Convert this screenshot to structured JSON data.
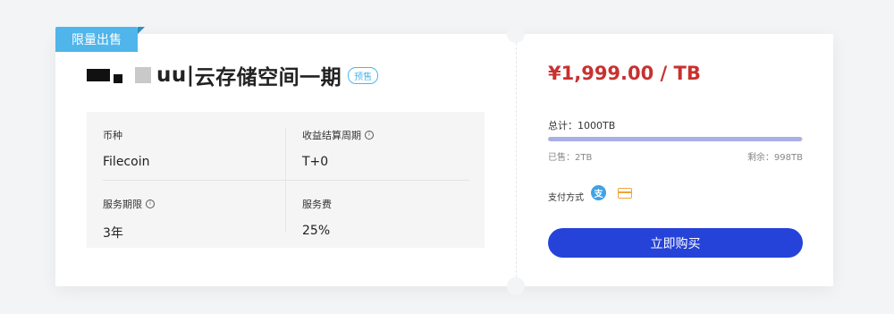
{
  "ribbon": {
    "label": "限量出售"
  },
  "product": {
    "title": "云存储空间一期",
    "title_partial": "uu|",
    "tag": "预售"
  },
  "details": {
    "coin": {
      "label": "币种",
      "value": "Filecoin"
    },
    "settlement_cycle": {
      "label": "收益结算周期",
      "value": "T+0"
    },
    "service_period": {
      "label": "服务期限",
      "value": "3年"
    },
    "service_fee": {
      "label": "服务费",
      "value": "25%"
    }
  },
  "pricing": {
    "price": "¥1,999.00 / TB",
    "total": "总计：1000TB",
    "sold": "已售：2TB",
    "remaining": "剩余：998TB",
    "sold_fraction": 0.998
  },
  "payment": {
    "label": "支付方式",
    "methods": [
      "alipay-icon",
      "card-icon"
    ],
    "alipay_glyph": "支"
  },
  "actions": {
    "buy_label": "立即购买"
  },
  "colors": {
    "accent": "#2543d8",
    "price": "#c8312f",
    "ribbon": "#4fb5ea",
    "progress": "#a8aee8"
  }
}
